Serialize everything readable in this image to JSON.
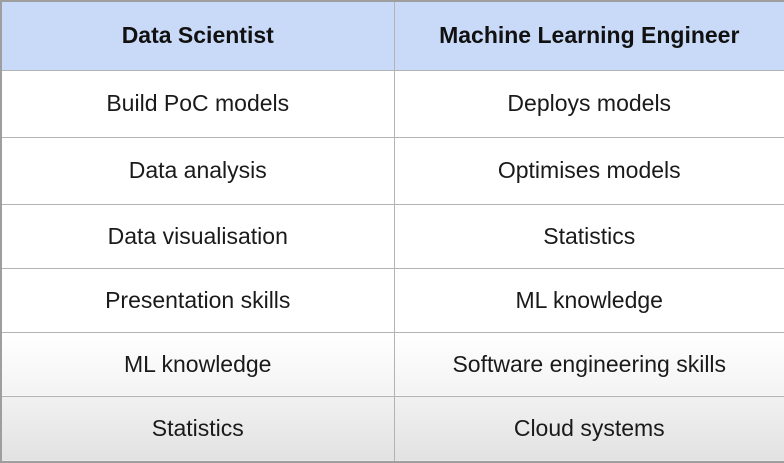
{
  "table": {
    "headers": [
      "Data Scientist",
      "Machine Learning Engineer"
    ],
    "rows": [
      [
        "Build PoC models",
        "Deploys models"
      ],
      [
        "Data analysis",
        "Optimises models"
      ],
      [
        "Data visualisation",
        "Statistics"
      ],
      [
        "Presentation skills",
        "ML knowledge"
      ],
      [
        "ML knowledge",
        "Software engineering skills"
      ],
      [
        "Statistics",
        "Cloud systems"
      ]
    ]
  },
  "colors": {
    "header_background": "#c9daf8",
    "grid_line": "#b3b3b3",
    "text": "#1a1a1a"
  }
}
